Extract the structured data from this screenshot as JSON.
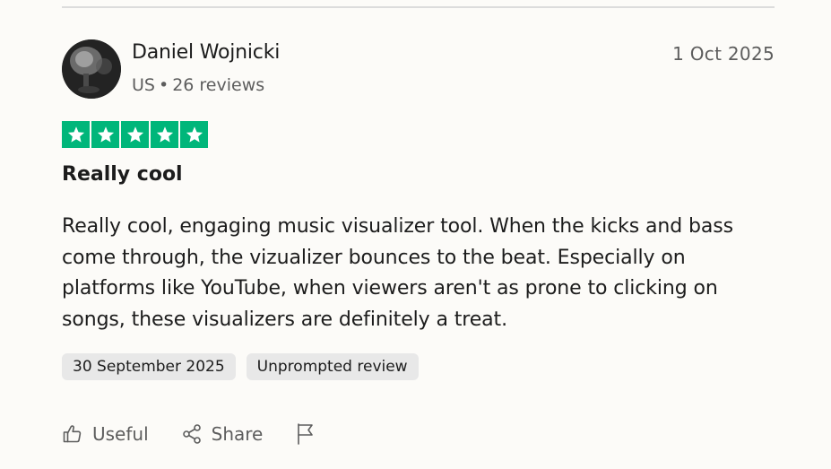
{
  "review": {
    "author": {
      "name": "Daniel Wojnicki",
      "country": "US",
      "separator": "•",
      "review_count": "26 reviews"
    },
    "date": "1 Oct 2025",
    "rating": 5,
    "rating_color": "#00b67a",
    "title": "Really cool",
    "body": "Really cool, engaging music visualizer tool. When the kicks and bass come through, the vizualizer bounces to the beat. Especially on platforms like YouTube, when viewers aren't as prone to clicking on songs, these visualizers are definitely a treat.",
    "tags": {
      "experience_date": "30 September 2025",
      "review_type": "Unprompted review"
    }
  },
  "actions": {
    "useful_label": "Useful",
    "useful_icon": "thumbs-up-icon",
    "share_label": "Share",
    "share_icon": "share-icon",
    "flag_icon": "flag-icon"
  }
}
